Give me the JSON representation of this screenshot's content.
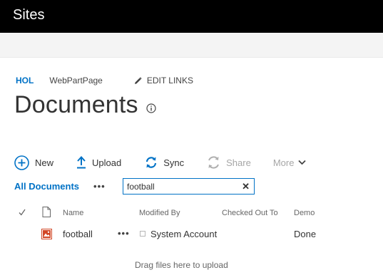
{
  "suite_bar": {
    "title": "Sites"
  },
  "breadcrumb": {
    "home": "HOL",
    "page": "WebPartPage",
    "edit_links": "EDIT LINKS"
  },
  "page": {
    "title": "Documents"
  },
  "command_bar": {
    "new": "New",
    "upload": "Upload",
    "sync": "Sync",
    "share": "Share",
    "more": "More"
  },
  "view": {
    "current": "All Documents",
    "search_value": "football"
  },
  "columns": {
    "name": "Name",
    "modified_by": "Modified By",
    "checked_out_to": "Checked Out To",
    "demo": "Demo"
  },
  "rows": [
    {
      "name": "football",
      "modified_by": "System Account",
      "checked_out_to": "",
      "demo": "Done"
    }
  ],
  "dropzone": {
    "text": "Drag files here to upload"
  },
  "colors": {
    "suite_bar": "#000000",
    "accent": "#0072c6",
    "disabled": "#a6a6a6",
    "file_icon": "#d24726"
  },
  "icons": [
    "pencil-icon",
    "info-icon",
    "plus-circle-icon",
    "upload-arrow-icon",
    "sync-icon",
    "share-icon",
    "chevron-down-icon",
    "ellipsis-icon",
    "clear-icon",
    "checkmark-icon",
    "document-icon",
    "image-file-icon"
  ]
}
